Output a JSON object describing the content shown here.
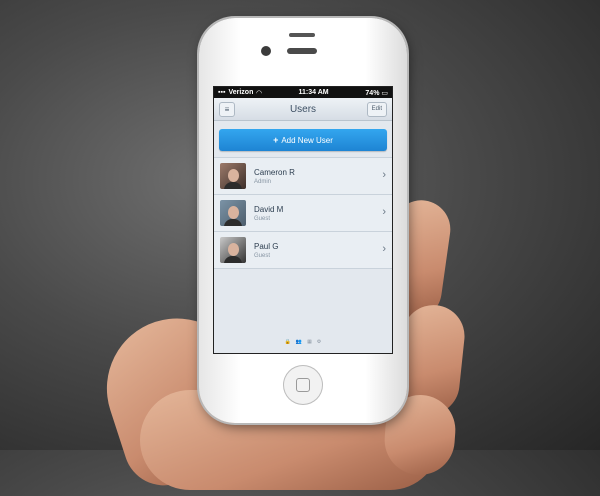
{
  "status_bar": {
    "carrier": "Verizon",
    "time": "11:34 AM",
    "battery": "74%"
  },
  "nav": {
    "title": "Users",
    "menu_icon": "menu-icon",
    "edit_label": "Edit"
  },
  "add_user_button": {
    "label": "Add New User",
    "icon": "plus-icon"
  },
  "users": [
    {
      "name": "Cameron R",
      "role": "Admin"
    },
    {
      "name": "David M",
      "role": "Guest"
    },
    {
      "name": "Paul G",
      "role": "Guest"
    }
  ],
  "bottom_tabs": [
    {
      "icon": "lock-icon",
      "glyph": "🔒"
    },
    {
      "icon": "users-icon",
      "glyph": "👥"
    },
    {
      "icon": "grid-icon",
      "glyph": "▦"
    },
    {
      "icon": "gear-icon",
      "glyph": "⚙"
    }
  ],
  "colors": {
    "accent": "#2b8ad9",
    "nav_title": "#3d4f63"
  }
}
